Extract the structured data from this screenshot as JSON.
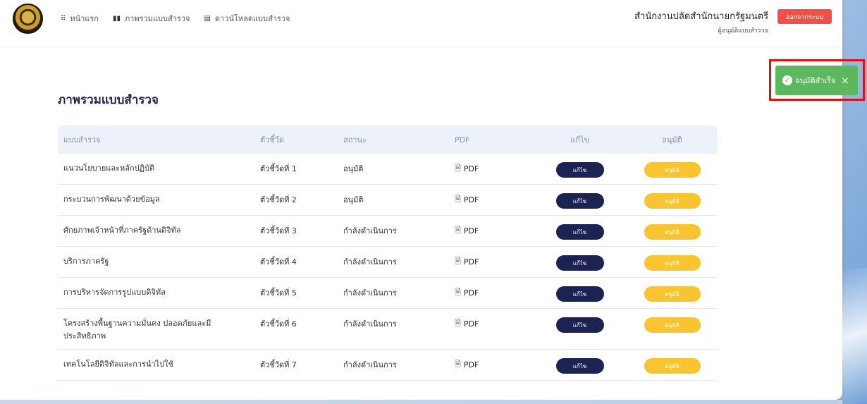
{
  "nav": {
    "items": [
      {
        "icon": "grid-icon",
        "glyph": "⠿",
        "label": "หน้าแรก"
      },
      {
        "icon": "bar-chart-icon",
        "glyph": "▮▮",
        "label": "ภาพรวมแบบสำรวจ"
      },
      {
        "icon": "table-icon",
        "glyph": "▤",
        "label": "ดาวน์โหลดแบบสำรวจ"
      }
    ]
  },
  "header": {
    "org_name": "สำนักงานปลัดสำนักนายกรัฐมนตรี",
    "org_role": "ผู้อนุมัติแบบสำรวจ",
    "logout_label": "ออกจากระบบ"
  },
  "page": {
    "title": "ภาพรวมแบบสำรวจ"
  },
  "table": {
    "headers": [
      "แบบสำรวจ",
      "ตัวชี้วัด",
      "สถานะ",
      "PDF",
      "แก้ไข",
      "อนุมัติ"
    ],
    "rows": [
      {
        "survey": "แนวนโยบายและหลักปฏิบัติ",
        "indicator": "ตัวชี้วัดที่ 1",
        "status": "อนุมัติ",
        "pdf": "PDF",
        "edit": "แก้ไข",
        "approve": "อนุมัติ"
      },
      {
        "survey": "กระบวนการพัฒนาด้วยข้อมูล",
        "indicator": "ตัวชี้วัดที่ 2",
        "status": "อนุมัติ",
        "pdf": "PDF",
        "edit": "แก้ไข",
        "approve": "อนุมัติ"
      },
      {
        "survey": "ศักยภาพเจ้าหน้าที่ภาครัฐด้านดิจิทัล",
        "indicator": "ตัวชี้วัดที่ 3",
        "status": "กำลังดำเนินการ",
        "pdf": "PDF",
        "edit": "แก้ไข",
        "approve": "อนุมัติ"
      },
      {
        "survey": "บริการภาครัฐ",
        "indicator": "ตัวชี้วัดที่ 4",
        "status": "กำลังดำเนินการ",
        "pdf": "PDF",
        "edit": "แก้ไข",
        "approve": "อนุมัติ"
      },
      {
        "survey": "การบริหารจัดการรูปแบบดิจิทัล",
        "indicator": "ตัวชี้วัดที่ 5",
        "status": "กำลังดำเนินการ",
        "pdf": "PDF",
        "edit": "แก้ไข",
        "approve": "อนุมัติ"
      },
      {
        "survey": "โครงสร้างพื้นฐานความมั่นคง ปลอดภัยและมีประสิทธิภาพ",
        "indicator": "ตัวชี้วัดที่ 6",
        "status": "กำลังดำเนินการ",
        "pdf": "PDF",
        "edit": "แก้ไข",
        "approve": "อนุมัติ"
      },
      {
        "survey": "เทคโนโลยีดิจิทัลและการนำไปใช้",
        "indicator": "ตัวชี้วัดที่ 7",
        "status": "กำลังดำเนินการ",
        "pdf": "PDF",
        "edit": "แก้ไข",
        "approve": "อนุมัติ"
      }
    ]
  },
  "toast": {
    "message": "อนุมัติสำเร็จ",
    "close_glyph": "×"
  },
  "colors": {
    "edit_button": "#1c2353",
    "approve_button": "#f8c42f",
    "logout_button": "#f0504a",
    "toast_success": "#5cb85c",
    "highlight_box": "#e10f0f"
  }
}
